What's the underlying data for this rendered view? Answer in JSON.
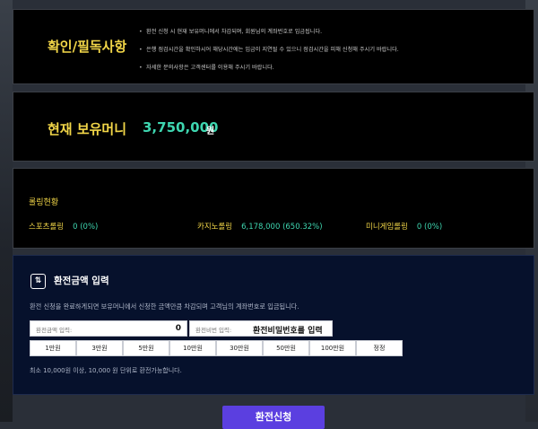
{
  "notice": {
    "title": "확인/필독사항",
    "items": [
      "환전 신청 시 현재 보유머니에서 차감되며, 회원님의 계좌번호로 입금됩니다.",
      "은행 점검시간을 확인하시어 해당시간에는 입금이 지연될 수 있으니 점검시간을 피해 신청해 주시기 바랍니다.",
      "자세한 문의사항은 고객센터를 이용해 주시기 바랍니다."
    ]
  },
  "balance": {
    "label": "현재 보유머니",
    "amount": "3,750,000",
    "unit": "원"
  },
  "rolling": {
    "title": "롤링현황",
    "items": [
      {
        "label": "스포츠롤링",
        "value": "0 (0%)"
      },
      {
        "label": "카지노롤링",
        "value": "6,178,000 (650.32%)"
      },
      {
        "label": "미니게임롤링",
        "value": "0 (0%)"
      }
    ]
  },
  "exchange": {
    "icon": "exchange-icon",
    "icon_glyph": "⇅",
    "title": "환전금액 입력",
    "description": "환전 신청을 완료하게되면 보유머니에서 신청한 금액만큼 차감되며 고객님의 계좌번호로 입금됩니다.",
    "amount_label": "환전금액 입력:",
    "amount_value": "0",
    "password_label": "환전비번 입력:",
    "password_placeholder": "환전비밀번호를 입력",
    "amount_buttons": [
      "1만원",
      "3만원",
      "5만원",
      "10만원",
      "30만원",
      "50만원",
      "100만원",
      "정정"
    ],
    "note": "최소 10,000원 이상, 10,000 원 단위로 환전가능합니다."
  },
  "submit_label": "환전신청"
}
